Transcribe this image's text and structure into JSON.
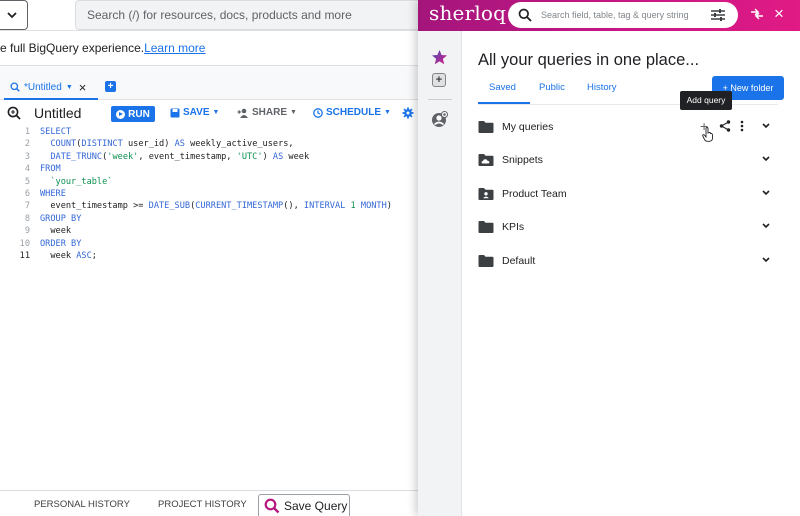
{
  "bigquery": {
    "search": {
      "placeholder": "Search (/) for resources, docs, products and more"
    },
    "banner": {
      "text": "e full BigQuery experience.",
      "link": "Learn more"
    },
    "tab": {
      "label": "*Untitled"
    },
    "toolbar": {
      "title": "Untitled",
      "run": "RUN",
      "save": "SAVE",
      "share": "SHARE",
      "schedule": "SCHEDULE"
    },
    "editor": {
      "active_line": 11,
      "lines": [
        {
          "n": "1",
          "text": "SELECT"
        },
        {
          "n": "2",
          "text": "  COUNT(DISTINCT user_id) AS weekly_active_users,"
        },
        {
          "n": "3",
          "text": "  DATE_TRUNC('week', event_timestamp, 'UTC') AS week"
        },
        {
          "n": "4",
          "text": "FROM"
        },
        {
          "n": "5",
          "text": "  `your_table`"
        },
        {
          "n": "6",
          "text": "WHERE"
        },
        {
          "n": "7",
          "text": "  event_timestamp >= DATE_SUB(CURRENT_TIMESTAMP(), INTERVAL 1 MONTH)"
        },
        {
          "n": "8",
          "text": "GROUP BY"
        },
        {
          "n": "9",
          "text": "  week"
        },
        {
          "n": "10",
          "text": "ORDER BY"
        },
        {
          "n": "11",
          "text": "  week ASC;"
        }
      ]
    },
    "bottom": {
      "personal_history": "PERSONAL HISTORY",
      "project_history": "PROJECT HISTORY",
      "save_query": "Save Query"
    }
  },
  "sherloq": {
    "logo": "sherloq",
    "search": {
      "placeholder": "Search field, table, tag & query string"
    },
    "colors": {
      "brand_start": "#a4157b",
      "brand_end": "#e11a85",
      "accent": "#1a73e8"
    },
    "title": "All your queries in one place...",
    "tabs": [
      {
        "label": "Saved",
        "active": true
      },
      {
        "label": "Public",
        "active": false
      },
      {
        "label": "History",
        "active": false
      }
    ],
    "new_folder": "+ New folder",
    "tooltip": "Add query",
    "folders": [
      {
        "name": "My queries",
        "icon": "folder-icon",
        "hovered": true
      },
      {
        "name": "Snippets",
        "icon": "cloud-folder-icon",
        "hovered": false
      },
      {
        "name": "Product Team",
        "icon": "shared-folder-icon",
        "hovered": false
      },
      {
        "name": "KPIs",
        "icon": "folder-icon",
        "hovered": false
      },
      {
        "name": "Default",
        "icon": "folder-icon",
        "hovered": false
      }
    ]
  }
}
